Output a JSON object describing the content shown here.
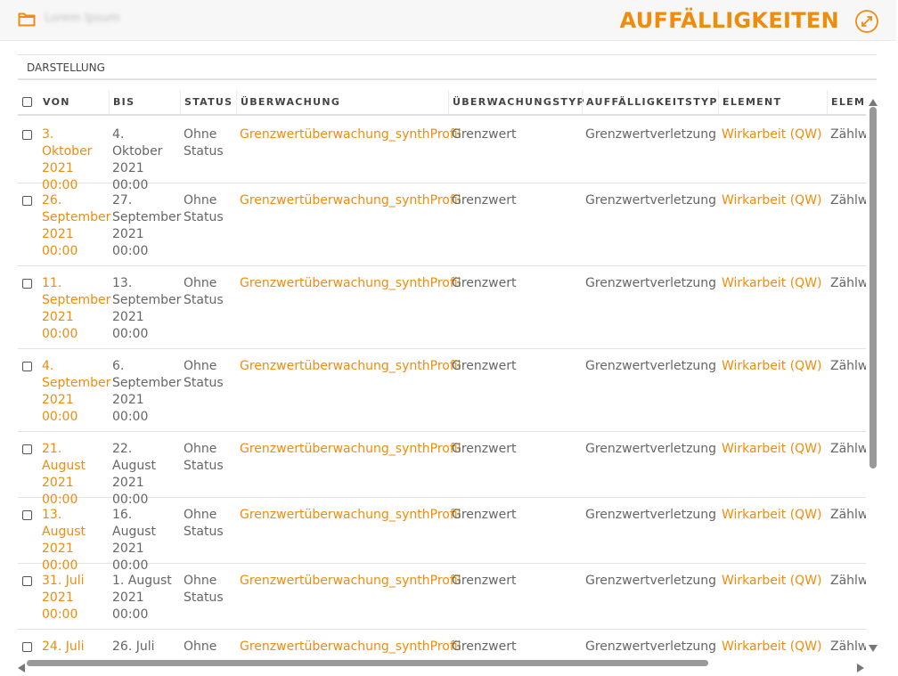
{
  "header": {
    "workspace_name": "Lorem Ipsum",
    "title": "AUFFÄLLIGKEITEN",
    "icons": {
      "folder": "folder-icon",
      "expand": "expand-icon"
    }
  },
  "toolbar": {
    "view_label": "DARSTELLUNG"
  },
  "table": {
    "columns": [
      "VON",
      "BIS",
      "STATUS",
      "ÜBERWACHUNG",
      "ÜBERWACHUNGSTYP",
      "AUFFÄLLIGKEITSTYP",
      "ELEMENT",
      "ELEM"
    ],
    "rows": [
      {
        "von": "3. Oktober 2021 00:00",
        "bis": "4. Oktober 2021 00:00",
        "status": "Ohne Status",
        "ueberwachung": "Grenzwertüberwachung_synthProfil",
        "typ": "Grenzwert",
        "auffaelligkeit": "Grenzwertverletzung",
        "element": "Wirkarbeit (QW)",
        "elem2": "Zählw"
      },
      {
        "von": "26. September 2021 00:00",
        "bis": "27. September 2021 00:00",
        "status": "Ohne Status",
        "ueberwachung": "Grenzwertüberwachung_synthProfil",
        "typ": "Grenzwert",
        "auffaelligkeit": "Grenzwertverletzung",
        "element": "Wirkarbeit (QW)",
        "elem2": "Zählw"
      },
      {
        "von": "11. September 2021 00:00",
        "bis": "13. September 2021 00:00",
        "status": "Ohne Status",
        "ueberwachung": "Grenzwertüberwachung_synthProfil",
        "typ": "Grenzwert",
        "auffaelligkeit": "Grenzwertverletzung",
        "element": "Wirkarbeit (QW)",
        "elem2": "Zählw"
      },
      {
        "von": "4. September 2021 00:00",
        "bis": "6. September 2021 00:00",
        "status": "Ohne Status",
        "ueberwachung": "Grenzwertüberwachung_synthProfil",
        "typ": "Grenzwert",
        "auffaelligkeit": "Grenzwertverletzung",
        "element": "Wirkarbeit (QW)",
        "elem2": "Zählw"
      },
      {
        "von": "21. August 2021 00:00",
        "bis": "22. August 2021 00:00",
        "status": "Ohne Status",
        "ueberwachung": "Grenzwertüberwachung_synthProfil",
        "typ": "Grenzwert",
        "auffaelligkeit": "Grenzwertverletzung",
        "element": "Wirkarbeit (QW)",
        "elem2": "Zählw"
      },
      {
        "von": "13. August 2021 00:00",
        "bis": "16. August 2021 00:00",
        "status": "Ohne Status",
        "ueberwachung": "Grenzwertüberwachung_synthProfil",
        "typ": "Grenzwert",
        "auffaelligkeit": "Grenzwertverletzung",
        "element": "Wirkarbeit (QW)",
        "elem2": "Zählw"
      },
      {
        "von": "31. Juli 2021 00:00",
        "bis": "1. August 2021 00:00",
        "status": "Ohne Status",
        "ueberwachung": "Grenzwertüberwachung_synthProfil",
        "typ": "Grenzwert",
        "auffaelligkeit": "Grenzwertverletzung",
        "element": "Wirkarbeit (QW)",
        "elem2": "Zählw"
      },
      {
        "von": "24. Juli",
        "bis": "26. Juli",
        "status": "Ohne",
        "ueberwachung": "Grenzwertüberwachung_synthProfil",
        "typ": "Grenzwert",
        "auffaelligkeit": "Grenzwertverletzung",
        "element": "Wirkarbeit (QW)",
        "elem2": "Zählw"
      }
    ]
  },
  "colors": {
    "accent": "#ef8c0d",
    "text": "#666666",
    "header_bg": "#f7f7f7"
  }
}
